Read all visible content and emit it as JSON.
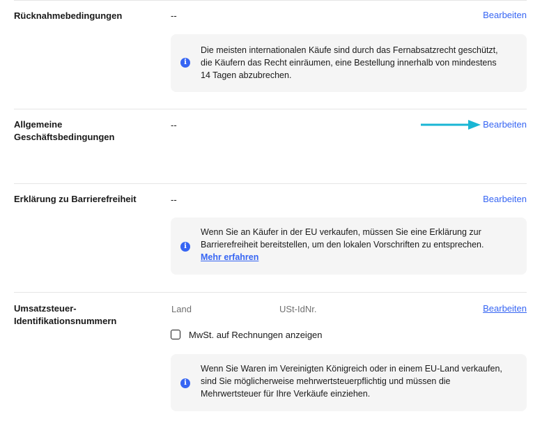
{
  "sections": {
    "returns": {
      "label": "Rücknahmebedingungen",
      "value": "--",
      "edit_label": "Bearbeiten",
      "info": {
        "icon": "info-icon",
        "lines": [
          "Die meisten internationalen Käufe sind durch das Fernabsatzrecht geschützt,",
          "die Käufern das Recht einräumen, eine Bestellung innerhalb von mindestens",
          "14 Tagen abzubrechen."
        ]
      }
    },
    "terms": {
      "label_lines": [
        "Allgemeine",
        "Geschäftsbedingungen"
      ],
      "value": "--",
      "edit_label": "Bearbeiten"
    },
    "accessibility": {
      "label": "Erklärung zu Barrierefreiheit",
      "value": "--",
      "edit_label": "Bearbeiten",
      "info": {
        "icon": "info-icon",
        "lines": [
          "Wenn Sie an Käufer in der EU verkaufen, müssen Sie eine Erklärung zur",
          "Barrierefreiheit bereitstellen, um den lokalen Vorschriften zu entsprechen."
        ],
        "link": "Mehr erfahren"
      }
    },
    "vat": {
      "label_lines": [
        "Umsatzsteuer-",
        "Identifikationsnummern"
      ],
      "country_label": "Land",
      "vat_id_label": "USt-IdNr.",
      "edit_label": "Bearbeiten",
      "checkbox_label": "MwSt. auf Rechnungen anzeigen",
      "checkbox_checked": false,
      "info": {
        "icon": "info-icon",
        "lines": [
          "Wenn Sie Waren im Vereinigten Königreich oder in einem EU-Land verkaufen,",
          "sind Sie möglicherweise mehrwertsteuerpflichtig und müssen die",
          "Mehrwertsteuer für Ihre Verkäufe einziehen."
        ]
      }
    }
  },
  "annotation": {
    "arrow_color": "#1ab6d4",
    "points_to": "Bearbeiten (Allgemeine Geschäftsbedingungen)"
  },
  "colors": {
    "link": "#3665f3",
    "info_bg": "#f5f5f5",
    "divider": "#e5e5e5"
  }
}
